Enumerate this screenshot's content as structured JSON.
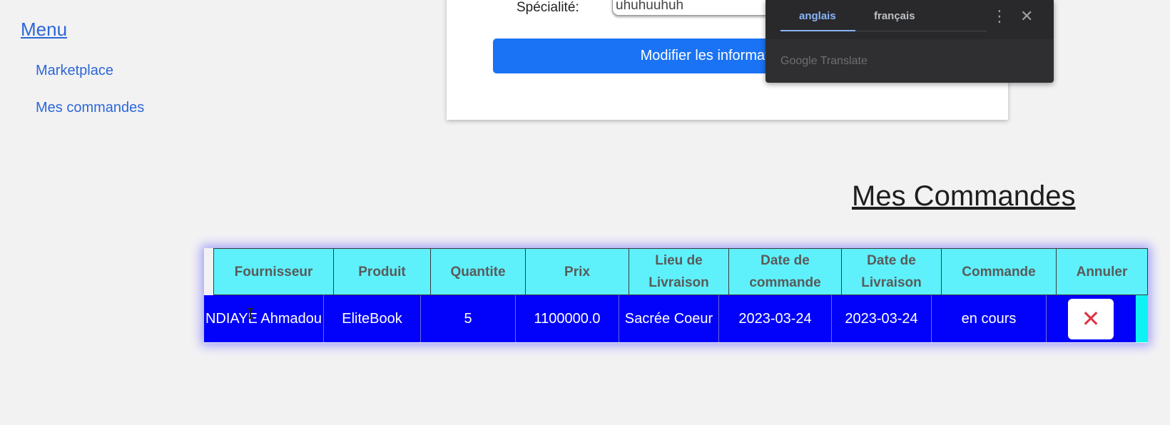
{
  "sidebar": {
    "title": "Menu",
    "items": [
      {
        "label": "Marketplace"
      },
      {
        "label": "Mes commandes"
      }
    ]
  },
  "profile": {
    "specialite_label": "Spécialité:",
    "specialite_value": "uhuhuuhuh",
    "modify_button": "Modifier les informations"
  },
  "translate_popup": {
    "tabs": [
      {
        "label": "anglais",
        "active": true
      },
      {
        "label": "français",
        "active": false
      }
    ],
    "brand": "Google Translate",
    "menu_icon": "kebab-icon",
    "close_icon": "close-icon"
  },
  "orders": {
    "heading": "Mes Commandes",
    "columns": [
      "Fournisseur",
      "Produit",
      "Quantite",
      "Prix",
      "Lieu de Livraison",
      "Date de commande",
      "Date de Livraison",
      "Commande",
      "Annuler"
    ],
    "rows": [
      {
        "fournisseur": "NDIAYE Ahmadou",
        "produit": "EliteBook",
        "quantite": "5",
        "prix": "1100000.0",
        "lieu": "Sacrée Coeur",
        "date_commande": "2023-03-24",
        "date_livraison": "2023-03-24",
        "commande": "en cours",
        "annuler_icon": "✕"
      }
    ]
  },
  "colors": {
    "header_bg": "#5ef1fb",
    "row_bg": "#0202fa",
    "button_blue": "#1a73f4",
    "cancel_red": "#dc3545",
    "link_blue": "#2b67d6"
  }
}
